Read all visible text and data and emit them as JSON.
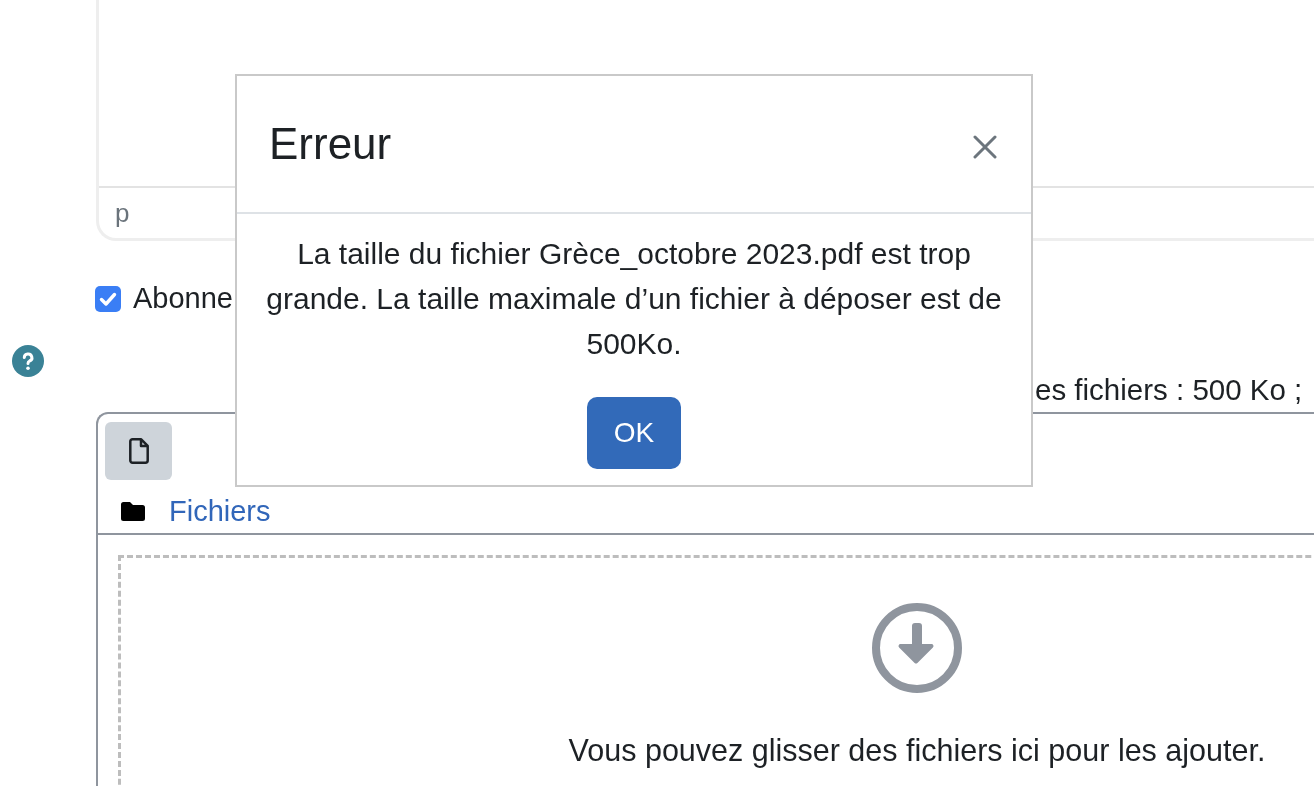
{
  "editor": {
    "status_path": "p"
  },
  "subscribe_checkbox": {
    "label": "Abonne",
    "checked": true
  },
  "file_limits_text": "es fichiers : 500 Ko ;",
  "file_manager": {
    "path": "Fichiers",
    "drop_hint": "Vous pouvez glisser des fichiers ici pour les ajouter."
  },
  "dialog": {
    "title": "Erreur",
    "message": "La taille du fichier Grèce_octobre 2023.pdf est trop grande. La taille maximale d’un fichier à déposer est de 500Ko.",
    "buttons": [
      "OK"
    ]
  }
}
